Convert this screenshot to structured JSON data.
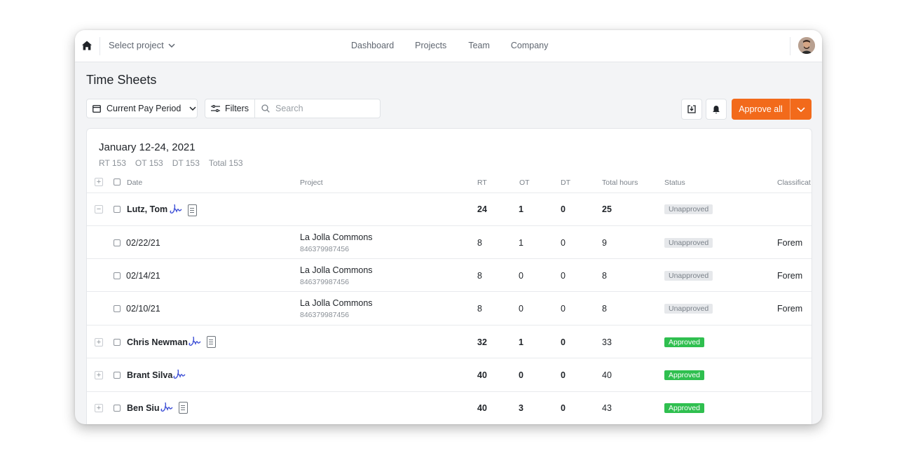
{
  "nav": {
    "project_select": "Select project",
    "links": [
      "Dashboard",
      "Projects",
      "Team",
      "Company"
    ]
  },
  "page": {
    "title": "Time Sheets",
    "period_label": "Current Pay Period",
    "filters_label": "Filters",
    "search_placeholder": "Search",
    "approve_label": "Approve all"
  },
  "period": {
    "title": "January 12-24, 2021",
    "totals": [
      "RT 153",
      "OT 153",
      "DT 153",
      "Total 153"
    ]
  },
  "columns": {
    "date": "Date",
    "project": "Project",
    "rt": "RT",
    "ot": "OT",
    "dt": "DT",
    "total": "Total hours",
    "status": "Status",
    "classification": "Classificat"
  },
  "rows": [
    {
      "name": "Lutz, Tom",
      "rt": "24",
      "ot": "1",
      "dt": "0",
      "total": "25",
      "status": "Unapproved"
    },
    {
      "date": "02/22/21",
      "project": "La Jolla Commons",
      "project_id": "846379987456",
      "rt": "8",
      "ot": "1",
      "dt": "0",
      "total": "9",
      "status": "Unapproved",
      "classification": "Forem"
    },
    {
      "date": "02/14/21",
      "project": "La Jolla Commons",
      "project_id": "846379987456",
      "rt": "8",
      "ot": "0",
      "dt": "0",
      "total": "8",
      "status": "Unapproved",
      "classification": "Forem"
    },
    {
      "date": "02/10/21",
      "project": "La Jolla Commons",
      "project_id": "846379987456",
      "rt": "8",
      "ot": "0",
      "dt": "0",
      "total": "8",
      "status": "Unapproved",
      "classification": "Forem"
    },
    {
      "name": "Chris Newman",
      "rt": "32",
      "ot": "1",
      "dt": "0",
      "total": "33",
      "status": "Approved"
    },
    {
      "name": "Brant Silva",
      "rt": "40",
      "ot": "0",
      "dt": "0",
      "total": "40",
      "status": "Approved"
    },
    {
      "name": "Ben Siu",
      "rt": "40",
      "ot": "3",
      "dt": "0",
      "total": "43",
      "status": "Approved"
    }
  ],
  "colors": {
    "accent": "#f26a1b",
    "approved": "#2fbf4f",
    "unapproved_bg": "#e6e8eb",
    "signature": "#3d4fd6"
  },
  "icons": [
    "home-icon",
    "chevron-down-icon",
    "calendar-icon",
    "sliders-icon",
    "search-icon",
    "download-icon",
    "bell-icon",
    "signature-icon",
    "document-icon"
  ]
}
